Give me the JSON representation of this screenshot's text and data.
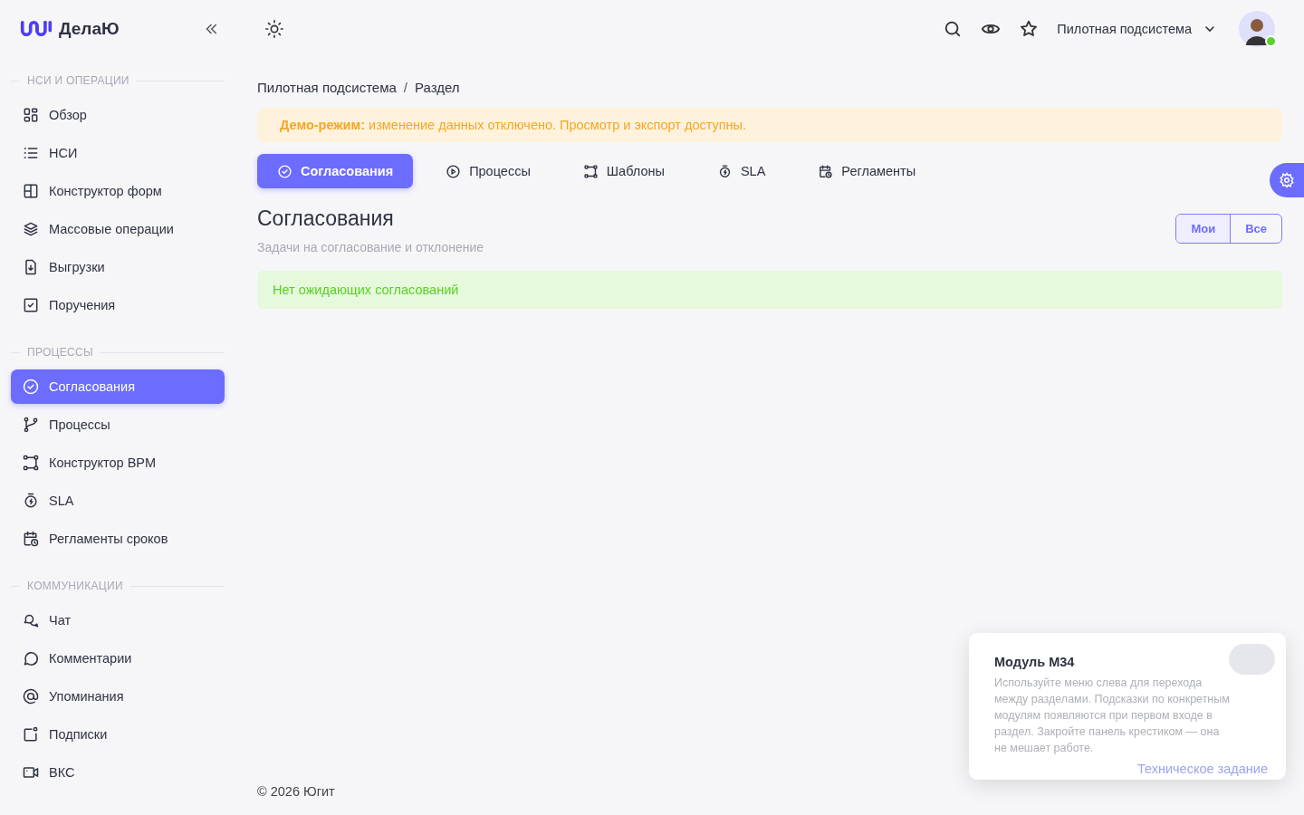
{
  "brand": {
    "name": "ДелаЮ"
  },
  "sidebar": {
    "sections": [
      {
        "title": "НСИ И ОПЕРАЦИИ",
        "items": [
          {
            "label": "Обзор",
            "selected": false
          },
          {
            "label": "НСИ",
            "selected": false
          },
          {
            "label": "Конструктор форм",
            "selected": false
          },
          {
            "label": "Массовые операции",
            "selected": false
          },
          {
            "label": "Выгрузки",
            "selected": false
          },
          {
            "label": "Поручения",
            "selected": false
          }
        ]
      },
      {
        "title": "ПРОЦЕССЫ",
        "items": [
          {
            "label": "Согласования",
            "selected": true
          },
          {
            "label": "Процессы",
            "selected": false
          },
          {
            "label": "Конструктор BPM",
            "selected": false
          },
          {
            "label": "SLA",
            "selected": false
          },
          {
            "label": "Регламенты сроков",
            "selected": false
          }
        ]
      },
      {
        "title": "КОММУНИКАЦИИ",
        "items": [
          {
            "label": "Чат",
            "selected": false
          },
          {
            "label": "Комментарии",
            "selected": false
          },
          {
            "label": "Упоминания",
            "selected": false
          },
          {
            "label": "Подписки",
            "selected": false
          },
          {
            "label": "ВКС",
            "selected": false
          }
        ]
      }
    ]
  },
  "header": {
    "subsystem": "Пилотная подсистема"
  },
  "breadcrumbs": {
    "items": [
      "Пилотная подсистема",
      "Раздел"
    ],
    "separator": "/"
  },
  "demo_banner": {
    "text": "**Демо-режим:** изменение данных отключено. Просмотр и экспорт доступны."
  },
  "tabs": [
    {
      "label": "Согласования",
      "selected": true
    },
    {
      "label": "Процессы",
      "selected": false
    },
    {
      "label": "Шаблоны",
      "selected": false
    },
    {
      "label": "SLA",
      "selected": false
    },
    {
      "label": "Регламенты",
      "selected": false
    }
  ],
  "page": {
    "title": "Согласования",
    "subtitle": "Задачи на согласование и отклонение"
  },
  "filter": [
    {
      "label": "Мои",
      "selected": true
    },
    {
      "label": "Все",
      "selected": false
    }
  ],
  "empty_message": "Нет ожидающих согласований",
  "footer": {
    "copyright": "© 2026 Югит"
  },
  "hint_panel": {
    "title": "Модуль М34",
    "text": "Используйте меню слева для перехода между разделами. Подсказки по конкретным модулям появляются при первом входе в раздел. Закройте панель крестиком — она не мешает работе.",
    "link": "Техническое задание"
  }
}
